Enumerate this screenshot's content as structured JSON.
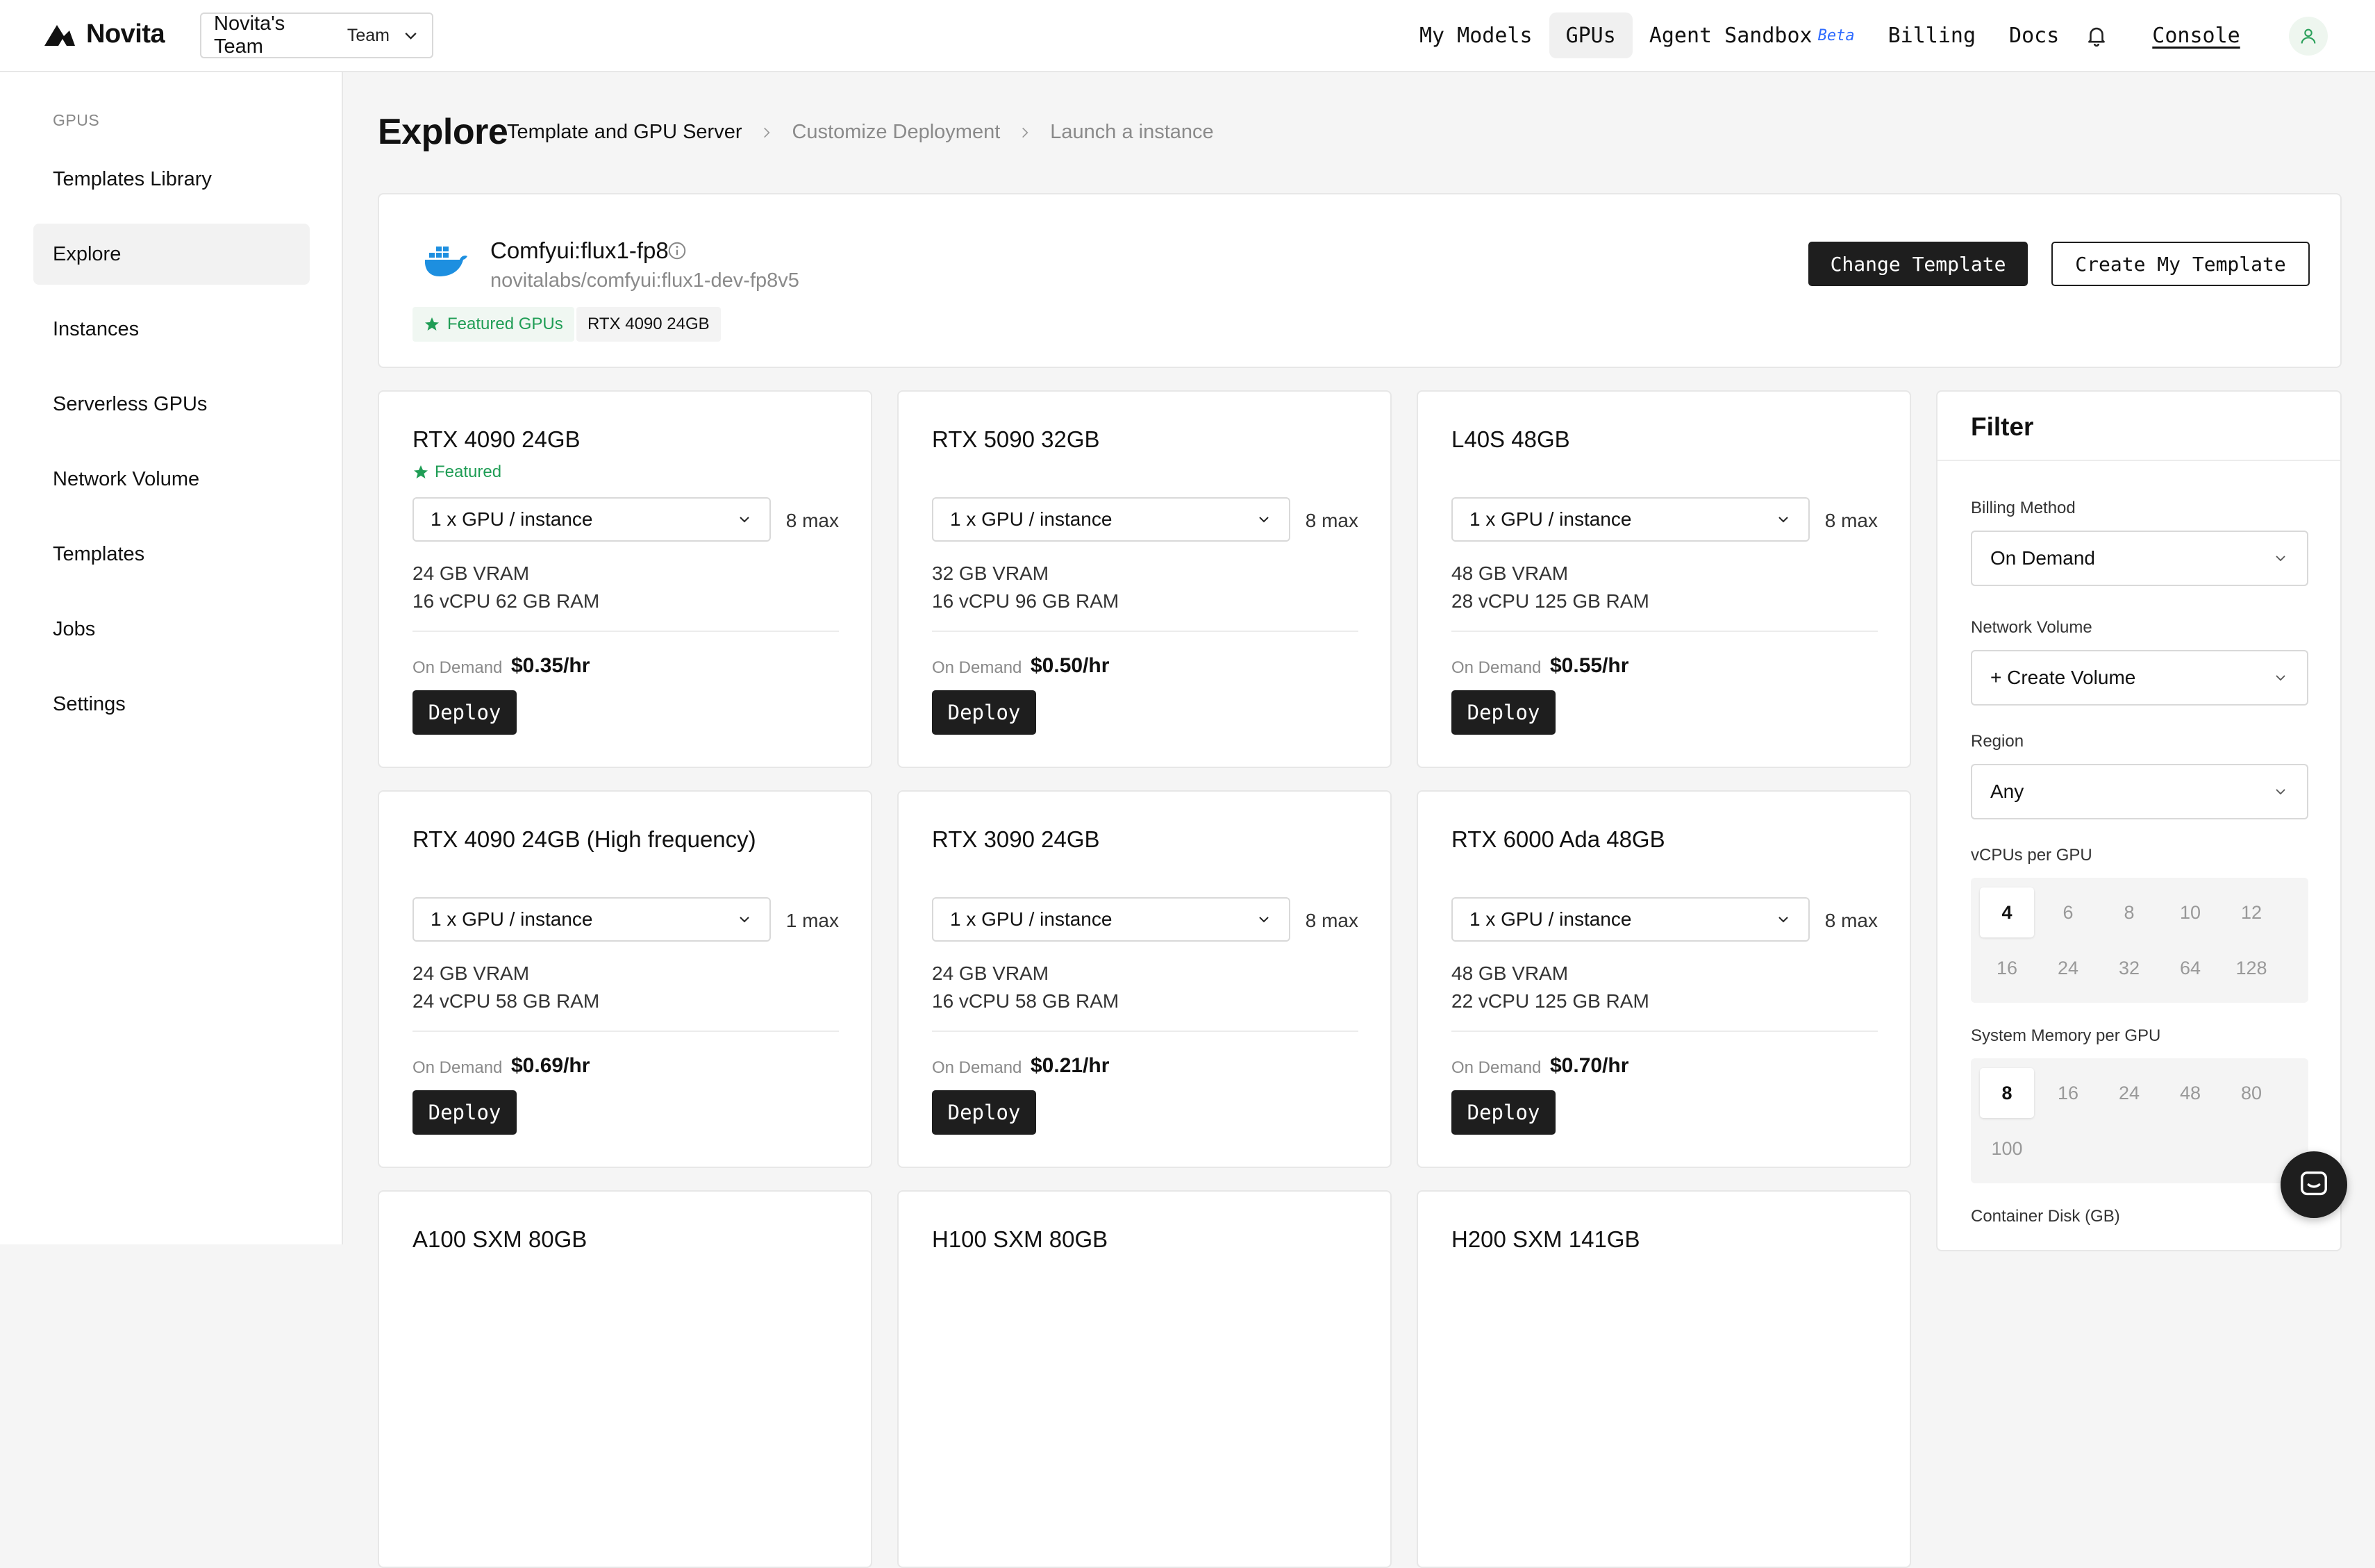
{
  "brand": {
    "name": "Novita"
  },
  "team": {
    "name": "Novita's Team",
    "tag": "Team"
  },
  "nav": {
    "items": [
      {
        "label": "My Models"
      },
      {
        "label": "GPUs"
      },
      {
        "label": "Agent Sandbox"
      },
      {
        "label": "Billing"
      },
      {
        "label": "Docs"
      }
    ],
    "beta": "Beta",
    "console": "Console"
  },
  "sidebar": {
    "section": "GPUS",
    "items": [
      {
        "label": "Templates Library"
      },
      {
        "label": "Explore"
      },
      {
        "label": "Instances"
      },
      {
        "label": "Serverless GPUs"
      },
      {
        "label": "Network Volume"
      },
      {
        "label": "Templates"
      },
      {
        "label": "Jobs"
      },
      {
        "label": "Settings"
      }
    ]
  },
  "page": {
    "title": "Explore"
  },
  "breadcrumb": [
    {
      "label": "Template and GPU Server"
    },
    {
      "label": "Customize Deployment"
    },
    {
      "label": "Launch a instance"
    }
  ],
  "template": {
    "name": "Comfyui:flux1-fp8",
    "path": "novitalabs/comfyui:flux1-dev-fp8v5",
    "tags": [
      "Featured GPUs",
      "RTX 4090 24GB"
    ],
    "change_label": "Change Template",
    "create_label": "Create My Template"
  },
  "gpus": [
    {
      "name": "RTX 4090 24GB",
      "featured": "Featured",
      "select": "1 x GPU / instance",
      "max": "8 max",
      "vram": "24 GB VRAM",
      "cpu": "16 vCPU 62 GB RAM",
      "billing": "On Demand",
      "price": "$0.35/hr",
      "deploy": "Deploy"
    },
    {
      "name": "RTX 5090 32GB",
      "featured": "",
      "select": "1 x GPU / instance",
      "max": "8 max",
      "vram": "32 GB VRAM",
      "cpu": "16 vCPU 96 GB RAM",
      "billing": "On Demand",
      "price": "$0.50/hr",
      "deploy": "Deploy"
    },
    {
      "name": "L40S 48GB",
      "featured": "",
      "select": "1 x GPU / instance",
      "max": "8 max",
      "vram": "48 GB VRAM",
      "cpu": "28 vCPU 125 GB RAM",
      "billing": "On Demand",
      "price": "$0.55/hr",
      "deploy": "Deploy"
    },
    {
      "name": "RTX 4090 24GB (High frequency)",
      "featured": "",
      "select": "1 x GPU / instance",
      "max": "1 max",
      "vram": "24 GB VRAM",
      "cpu": "24 vCPU 58 GB RAM",
      "billing": "On Demand",
      "price": "$0.69/hr",
      "deploy": "Deploy"
    },
    {
      "name": "RTX 3090 24GB",
      "featured": "",
      "select": "1 x GPU / instance",
      "max": "8 max",
      "vram": "24 GB VRAM",
      "cpu": "16 vCPU 58 GB RAM",
      "billing": "On Demand",
      "price": "$0.21/hr",
      "deploy": "Deploy"
    },
    {
      "name": "RTX 6000 Ada 48GB",
      "featured": "",
      "select": "1 x GPU / instance",
      "max": "8 max",
      "vram": "48 GB VRAM",
      "cpu": "22 vCPU 125 GB RAM",
      "billing": "On Demand",
      "price": "$0.70/hr",
      "deploy": "Deploy"
    },
    {
      "name": "A100 SXM 80GB"
    },
    {
      "name": "H100 SXM 80GB"
    },
    {
      "name": "H200 SXM 141GB"
    }
  ],
  "filter": {
    "title": "Filter",
    "billing_label": "Billing Method",
    "billing_value": "On Demand",
    "volume_label": "Network Volume",
    "volume_value": "+ Create Volume",
    "region_label": "Region",
    "region_value": "Any",
    "vcpu_label": "vCPUs per GPU",
    "vcpu_options": [
      "4",
      "6",
      "8",
      "10",
      "12",
      "16",
      "24",
      "32",
      "64",
      "128"
    ],
    "memory_label": "System Memory per GPU",
    "memory_options": [
      "8",
      "16",
      "24",
      "48",
      "80",
      "100"
    ],
    "disk_label": "Container Disk (GB)"
  },
  "colors": {
    "accent": "#1f9d55",
    "beta": "#2e6bff",
    "button": "#1e1e1e"
  }
}
